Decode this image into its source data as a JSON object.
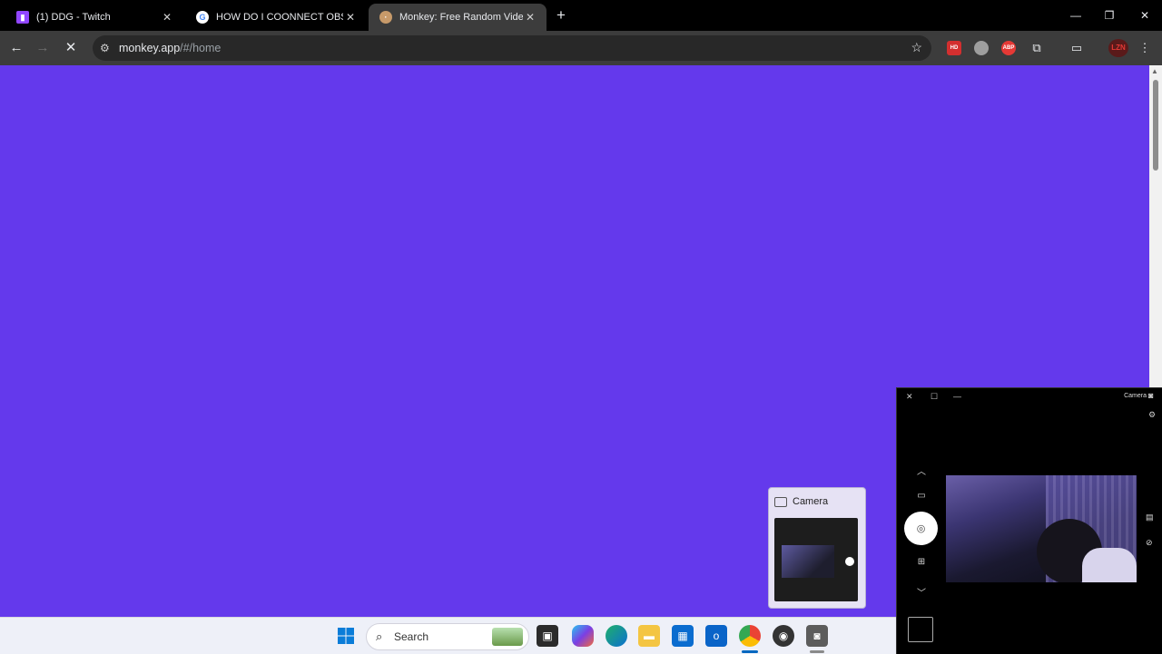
{
  "browser": {
    "tabs": [
      {
        "title": "(1) DDG - Twitch",
        "favicon": "twitch-icon",
        "active": false
      },
      {
        "title": "HOW DO I COONNECT OBS STI",
        "favicon": "google-icon",
        "active": false
      },
      {
        "title": "Monkey: Free Random Video C",
        "favicon": "monkey-icon",
        "active": true
      }
    ],
    "new_tab_icon": "+",
    "address": {
      "host": "monkey.app",
      "path": "/#/home"
    },
    "extensions": [
      {
        "name": "hd-extension-icon",
        "label": "HD",
        "color": "#d32f2f"
      },
      {
        "name": "circle-extension-icon",
        "label": "",
        "color": "#9e9e9e"
      },
      {
        "name": "adblock-extension-icon",
        "label": "ABP",
        "color": "#e53935"
      }
    ],
    "profile_label": "LZN"
  },
  "page": {
    "background": "#6439ec"
  },
  "camera_preview": {
    "title": "Camera"
  },
  "camera_window": {
    "title": "Camera"
  },
  "taskbar": {
    "search_placeholder": "Search",
    "accent": "#0067c0"
  }
}
